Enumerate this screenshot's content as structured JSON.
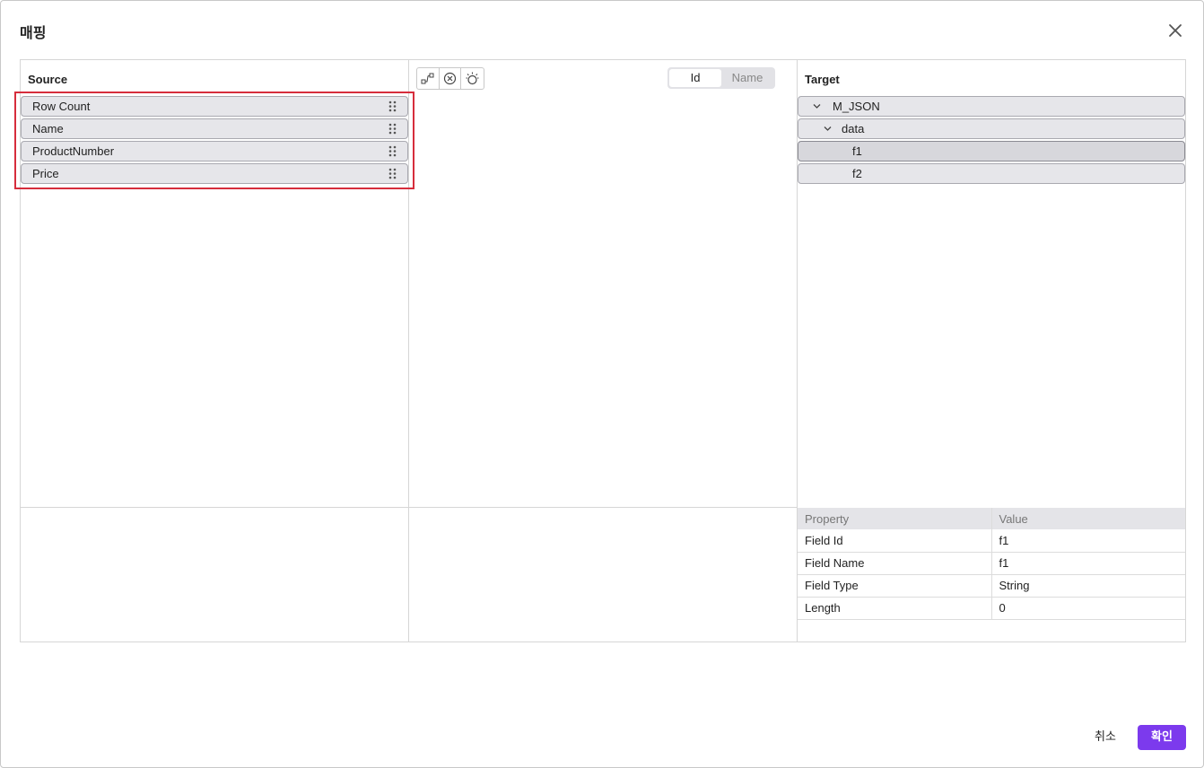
{
  "dialog": {
    "title": "매핑",
    "close_icon": "close-icon"
  },
  "source": {
    "header": "Source",
    "items": [
      {
        "label": "Row Count"
      },
      {
        "label": "Name"
      },
      {
        "label": "ProductNumber"
      },
      {
        "label": "Price"
      }
    ]
  },
  "toolbar": {
    "tools": [
      "auto-map-icon",
      "clear-mapping-icon",
      "bulb-icon"
    ],
    "toggle": {
      "options": [
        "Id",
        "Name"
      ],
      "selected": "Id"
    }
  },
  "target": {
    "header": "Target",
    "tree": [
      {
        "label": "M_JSON",
        "expanded": true,
        "level": 0
      },
      {
        "label": "data",
        "expanded": true,
        "level": 1
      },
      {
        "label": "f1",
        "level": 2,
        "selected": true
      },
      {
        "label": "f2",
        "level": 2
      }
    ]
  },
  "properties": {
    "headers": [
      "Property",
      "Value"
    ],
    "rows": [
      [
        "Field Id",
        "f1"
      ],
      [
        "Field Name",
        "f1"
      ],
      [
        "Field Type",
        "String"
      ],
      [
        "Length",
        "0"
      ]
    ]
  },
  "footer": {
    "cancel_label": "취소",
    "ok_label": "확인"
  },
  "colors": {
    "accent": "#7c3aed",
    "highlight": "#d62d3c",
    "item_bg": "#e6e6ea"
  }
}
